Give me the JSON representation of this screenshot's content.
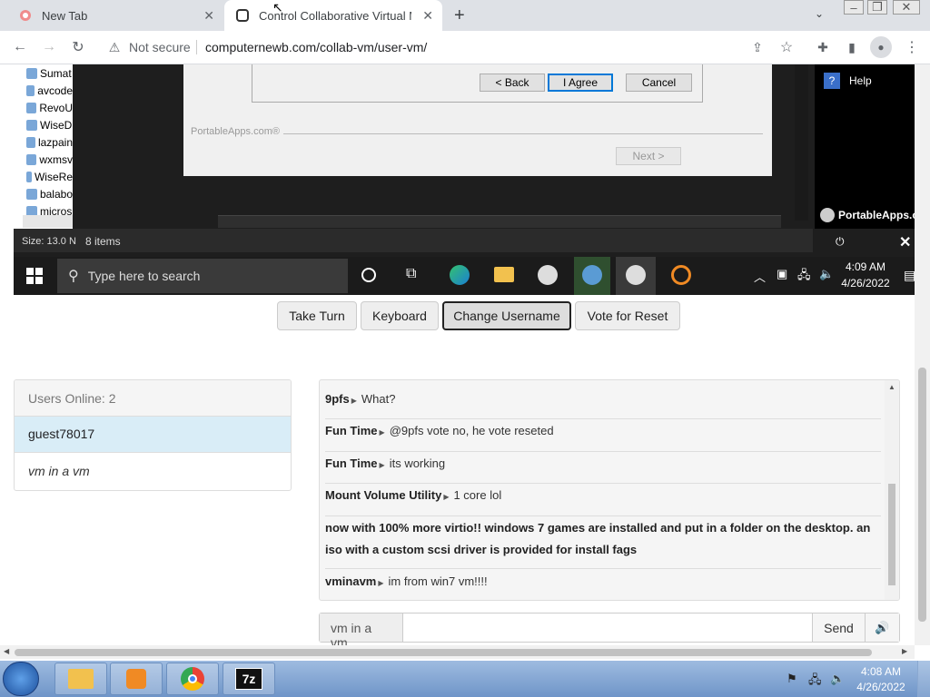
{
  "browser": {
    "tabs": [
      {
        "title": "New Tab"
      },
      {
        "title": "Control Collaborative Virtual Ma"
      }
    ],
    "not_secure": "Not secure",
    "url": "computernewb.com/collab-vm/user-vm/"
  },
  "vm": {
    "explorer_items": [
      "Sumat",
      "avcode",
      "RevoU",
      "WiseD",
      "lazpain",
      "wxmsv",
      "WiseRe",
      "balabo",
      "micros"
    ],
    "status_size": "Size: 13.0 N",
    "status_items": "8 items",
    "dialog": {
      "back": "< Back",
      "agree": "I Agree",
      "cancel": "Cancel",
      "branding": "PortableApps.com®",
      "next": "Next >"
    },
    "side_menu": {
      "help": "Help",
      "brand": "PortableApps.c"
    },
    "taskbar": {
      "search_placeholder": "Type here to search",
      "time": "4:09 AM",
      "date": "4/26/2022"
    }
  },
  "controls": {
    "take_turn": "Take Turn",
    "keyboard": "Keyboard",
    "change_username": "Change Username",
    "vote_reset": "Vote for Reset"
  },
  "users": {
    "header": "Users Online: 2",
    "list": [
      "guest78017",
      "vm in a vm"
    ]
  },
  "chat": {
    "messages": [
      {
        "user": "9pfs",
        "text": "What?"
      },
      {
        "user": "Fun Time",
        "text": "@9pfs vote no, he vote reseted"
      },
      {
        "user": "Fun Time",
        "text": "its working"
      },
      {
        "user": "Mount Volume Utility",
        "text": "1 core lol"
      },
      {
        "user": "",
        "text": "now with 100% more virtio!! windows 7 games are installed and put in a folder on the desktop. an iso with a custom scsi driver is provided for install fags"
      },
      {
        "user": "vminavm",
        "text": "im from win7 vm!!!!"
      }
    ],
    "username": "vm in a vm",
    "send": "Send"
  },
  "host_taskbar": {
    "time": "4:08 AM",
    "date": "4/26/2022"
  }
}
